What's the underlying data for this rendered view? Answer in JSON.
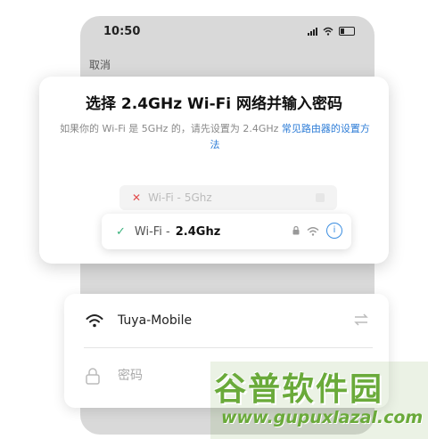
{
  "status_bar": {
    "time": "10:50"
  },
  "header": {
    "cancel_label": "取消"
  },
  "dialog": {
    "title": "选择 2.4GHz Wi-Fi 网络并输入密码",
    "subtitle_text": "如果你的 Wi-Fi 是 5GHz 的，请先设置为 2.4GHz ",
    "subtitle_link": "常见路由器的设置方法",
    "ghost_network": {
      "prefix": "Wi-Fi - ",
      "band": "5Ghz"
    },
    "selected_network": {
      "prefix": "Wi-Fi - ",
      "band": "2.4Ghz",
      "info_glyph": "i"
    }
  },
  "form": {
    "ssid": "Tuya-Mobile",
    "password_placeholder": "密码",
    "password_value": ""
  },
  "watermark": {
    "title": "谷普软件园",
    "url": "www.gupuxlazal.com"
  },
  "colors": {
    "accent_link": "#2e7dd7",
    "check_green": "#3bb37d",
    "error_red": "#e24d4d",
    "info_blue": "#3a8de0"
  }
}
